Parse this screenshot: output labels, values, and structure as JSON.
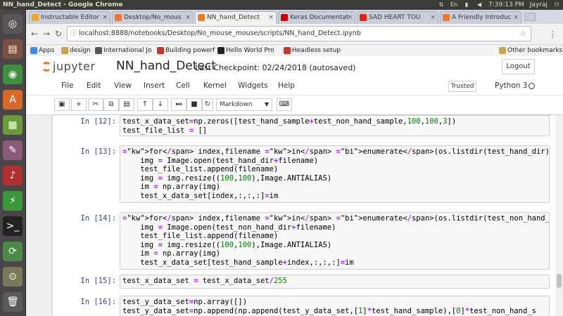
{
  "os": {
    "window_title": "NN_hand_Detect - Google Chrome",
    "clock": "7:39:13 PM",
    "user": "Jayraj"
  },
  "tabs": [
    {
      "label": "Instructable Editor",
      "color": "#f5a623"
    },
    {
      "label": "Desktop/No_mous",
      "color": "#f37726"
    },
    {
      "label": "NN_hand_Detect",
      "color": "#f37726"
    },
    {
      "label": "Keras Documentat",
      "color": "#d00000"
    },
    {
      "label": "SAD HEART TOU",
      "color": "#e62117"
    },
    {
      "label": "A Friendly Introduc",
      "color": "#f37726"
    }
  ],
  "address": {
    "url": "localhost:8888/notebooks/Desktop/No_mouse_mouse/scripts/NN_hand_Detect.ipynb"
  },
  "bookmarks": {
    "apps": "Apps",
    "items": [
      "design",
      "International Jo",
      "Building powerf",
      "Hello World Pro",
      "Headless setup"
    ],
    "other": "Other bookmarks"
  },
  "jupyter": {
    "logo_text": "jupyter",
    "notebook_title": "NN_hand_Detect",
    "checkpoint": "Last Checkpoint: 02/24/2018 (autosaved)",
    "logout": "Logout",
    "menus": [
      "File",
      "Edit",
      "View",
      "Insert",
      "Cell",
      "Kernel",
      "Widgets",
      "Help"
    ],
    "trusted": "Trusted",
    "kernel": "Python 3",
    "cell_type": "Markdown"
  },
  "cells": [
    {
      "prompt": "In [12]:",
      "lines": [
        "test_x_data_set=np.zeros([test_hand_sample+test_non_hand_sample,100,100,3])",
        "test_file_list = []"
      ]
    },
    {
      "prompt": "In [13]:",
      "lines": [
        "for index,filename in enumerate(os.listdir(test_hand_dir)):",
        "    img = Image.open(test_hand_dir+filename)",
        "    test_file_list.append(filename)",
        "    img = img.resize((100,100),Image.ANTIALIAS)",
        "    im = np.array(img)",
        "    test_x_data_set[index,:,:,:]=im"
      ]
    },
    {
      "prompt": "In [14]:",
      "lines": [
        "for index,filename in enumerate(os.listdir(test_non_hand_dir)):",
        "    img = Image.open(test_non_hand_dir+filename)",
        "    test_file_list.append(filename)",
        "    img = img.resize((100,100),Image.ANTIALIAS)",
        "    im = np.array(img)",
        "    test_x_data_set[test_hand_sample+index,:,:,:]=im"
      ]
    },
    {
      "prompt": "In [15]:",
      "lines": [
        "test_x_data_set = test_x_data_set/255"
      ]
    },
    {
      "prompt": "In [16]:",
      "lines": [
        "test_y_data_set=np.array([])",
        "test_y_data_set=np.append(np.append(test_y_data_set,[1]*test_hand_sample),[0]*test_non_hand_s"
      ]
    }
  ]
}
